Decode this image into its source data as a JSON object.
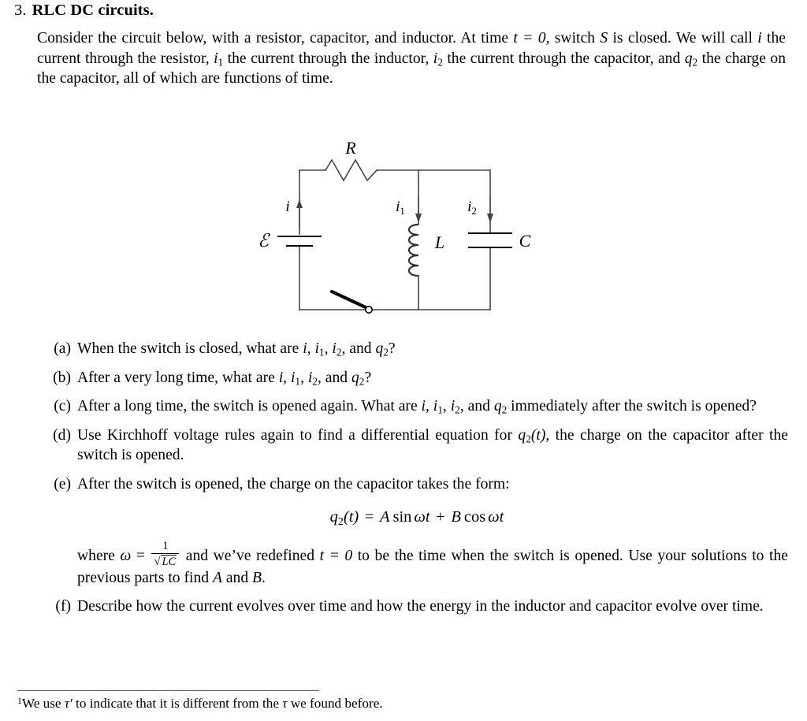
{
  "problem": {
    "number": "3.",
    "title": "RLC DC circuits.",
    "intro_line1": "Consider the circuit below, with a resistor, capacitor, and inductor. At time ",
    "intro_t_eq_zero": "t = 0",
    "intro_line1b": ", switch ",
    "intro_switch_symbol": "S",
    "intro_line1c": " is closed. We will call ",
    "intro_i": "i",
    "intro_line2": " the current through the resistor, ",
    "intro_i1": "i",
    "intro_i1_sub": "1",
    "intro_line3": " the current through the inductor, ",
    "intro_i2": "i",
    "intro_i2_sub": "2",
    "intro_line4": " the current through the capacitor, and ",
    "intro_q2": "q",
    "intro_q2_sub": "2",
    "intro_line5": " the charge on the capacitor, all of which are functions of time."
  },
  "circuit": {
    "resistor_label": "R",
    "emf_label": "ℰ",
    "inductor_label": "L",
    "capacitor_label": "C",
    "current_i_label": "i",
    "current_i1_label": "i",
    "current_i1_sub": "1",
    "current_i2_label": "i",
    "current_i2_sub": "2",
    "components": [
      "battery",
      "resistor",
      "inductor",
      "capacitor",
      "switch"
    ],
    "line_color": "#444444",
    "switch_color": "#000000"
  },
  "questions": [
    {
      "label": "(a)",
      "text_a": "When the switch is closed, what are ",
      "vars": [
        "i",
        "i1",
        "i2",
        "q2"
      ],
      "text_b": "?"
    },
    {
      "label": "(b)",
      "text_a": "After a very long time, what are ",
      "vars": [
        "i",
        "i1",
        "i2",
        "q2"
      ],
      "text_b": "?"
    },
    {
      "label": "(c)",
      "text_a": "After a long time, the switch is opened again. What are ",
      "vars": [
        "i",
        "i1",
        "i2",
        "q2"
      ],
      "text_b": " immediately after the switch is opened?"
    },
    {
      "label": "(d)",
      "text_a": "Use Kirchhoff voltage rules again to find a differential equation for ",
      "text_q2t": "q₂(t)",
      "text_b": ", the charge on the capacitor after the switch is opened."
    },
    {
      "label": "(e)",
      "text_a": "After the switch is opened, the charge on the capacitor takes the form:",
      "equation": {
        "lhs_var": "q",
        "lhs_sub": "2",
        "lhs_arg": "(t)",
        "equals": "=",
        "term1_coef": "A",
        "term1_fn": "sin",
        "term1_arg": "ωt",
        "plus": "+",
        "term2_coef": "B",
        "term2_fn": "cos",
        "term2_arg": "ωt"
      },
      "where_text_a": "where ",
      "where_omega": "ω",
      "where_equals": " = ",
      "frac_num": "1",
      "frac_den_radical": "√",
      "frac_den": "LC",
      "where_text_b": " and we’ve redefined ",
      "where_t_eq_zero": "t = 0",
      "where_text_c": " to be the time when the switch is opened. Use your solutions to the previous parts to find ",
      "where_A": "A",
      "where_and": " and ",
      "where_B": "B",
      "where_period": "."
    },
    {
      "label": "(f)",
      "text_a": "Describe how the current evolves over time and how the energy in the inductor and capacitor evolve over time."
    }
  ],
  "footnote": {
    "marker": "1",
    "text_a": "We use ",
    "tau_prime": "τ′",
    "text_b": " to indicate that it is different from the ",
    "tau": "τ",
    "text_c": " we found before."
  }
}
